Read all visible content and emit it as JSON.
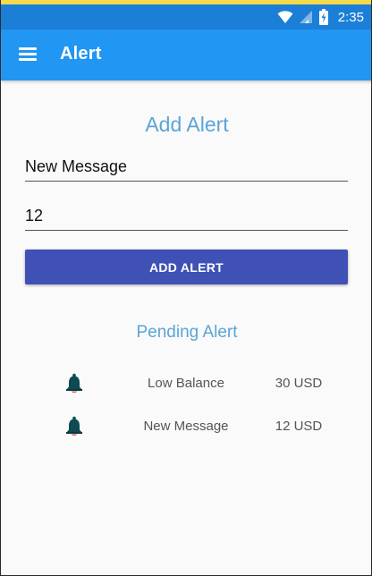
{
  "status_bar": {
    "time": "2:35",
    "icons": [
      "wifi-icon",
      "cell-signal-icon",
      "battery-icon"
    ]
  },
  "app_bar": {
    "menu_icon": "hamburger-menu-icon",
    "title": "Alert"
  },
  "form": {
    "heading": "Add Alert",
    "message_value": "New Message",
    "amount_value": "12",
    "button_label": "ADD ALERT"
  },
  "pending": {
    "heading": "Pending Alert",
    "alerts": [
      {
        "icon": "bell-icon",
        "name": "Low Balance",
        "amount": "30 USD"
      },
      {
        "icon": "bell-icon",
        "name": "New Message",
        "amount": "12 USD"
      }
    ]
  },
  "colors": {
    "app_bar": "#2196f3",
    "status_bar": "#1b7fd8",
    "accent_text": "#5aa5d6",
    "button": "#3f51b5",
    "bell": "#0e4a52"
  }
}
